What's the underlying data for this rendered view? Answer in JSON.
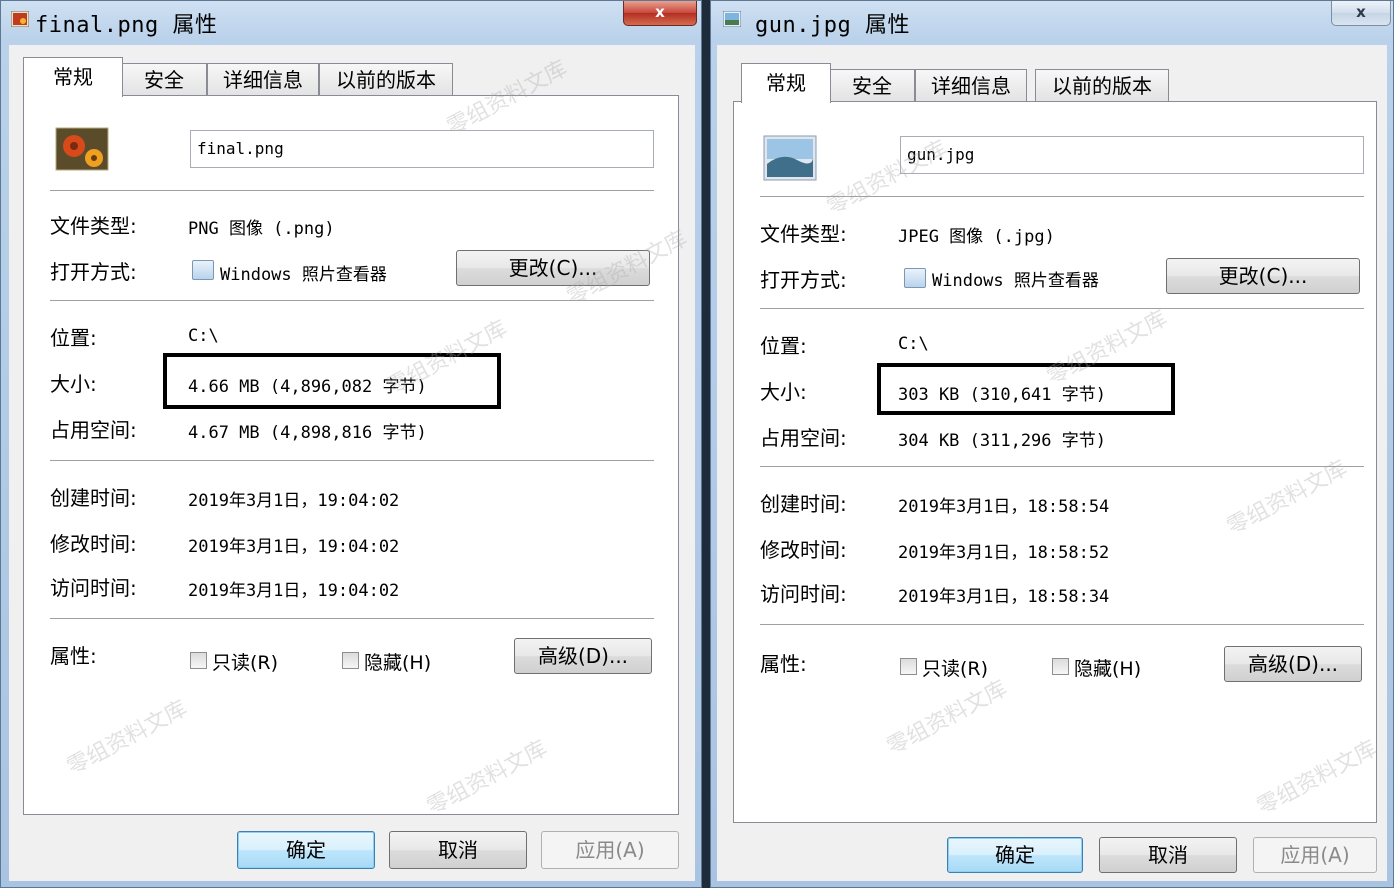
{
  "left": {
    "title": "final.png 属性",
    "tabs": [
      "常规",
      "安全",
      "详细信息",
      "以前的版本"
    ],
    "file_name": "final.png",
    "type_label": "文件类型:",
    "type_value": "PNG 图像 (.png)",
    "open_label": "打开方式:",
    "open_value": "Windows 照片查看器",
    "change_button": "更改(C)...",
    "location_label": "位置:",
    "location_value": "C:\\",
    "size_label": "大小:",
    "size_value": "4.66 MB (4,896,082 字节)",
    "disk_label": "占用空间:",
    "disk_value": "4.67 MB (4,898,816 字节)",
    "created_label": "创建时间:",
    "created_value": "2019年3月1日，19:04:02",
    "modified_label": "修改时间:",
    "modified_value": "2019年3月1日，19:04:02",
    "accessed_label": "访问时间:",
    "accessed_value": "2019年3月1日，19:04:02",
    "attr_label": "属性:",
    "readonly_label": "只读(R)",
    "hidden_label": "隐藏(H)",
    "advanced_button": "高级(D)...",
    "ok_button": "确定",
    "cancel_button": "取消",
    "apply_button": "应用(A)",
    "close_glyph": "x"
  },
  "right": {
    "title": "gun.jpg 属性",
    "tabs": [
      "常规",
      "安全",
      "详细信息",
      "以前的版本"
    ],
    "file_name": "gun.jpg",
    "type_label": "文件类型:",
    "type_value": "JPEG 图像 (.jpg)",
    "open_label": "打开方式:",
    "open_value": "Windows 照片查看器",
    "change_button": "更改(C)...",
    "location_label": "位置:",
    "location_value": "C:\\",
    "size_label": "大小:",
    "size_value": "303 KB (310,641 字节)",
    "disk_label": "占用空间:",
    "disk_value": "304 KB (311,296 字节)",
    "created_label": "创建时间:",
    "created_value": "2019年3月1日，18:58:54",
    "modified_label": "修改时间:",
    "modified_value": "2019年3月1日，18:58:52",
    "accessed_label": "访问时间:",
    "accessed_value": "2019年3月1日，18:58:34",
    "attr_label": "属性:",
    "readonly_label": "只读(R)",
    "hidden_label": "隐藏(H)",
    "advanced_button": "高级(D)...",
    "ok_button": "确定",
    "cancel_button": "取消",
    "apply_button": "应用(A)",
    "close_glyph": "x"
  },
  "watermark": "零组资料文库",
  "colors": {
    "highlight_box": "#000000",
    "close_active": "#c7463a",
    "default_button": "#3c7fb1"
  }
}
